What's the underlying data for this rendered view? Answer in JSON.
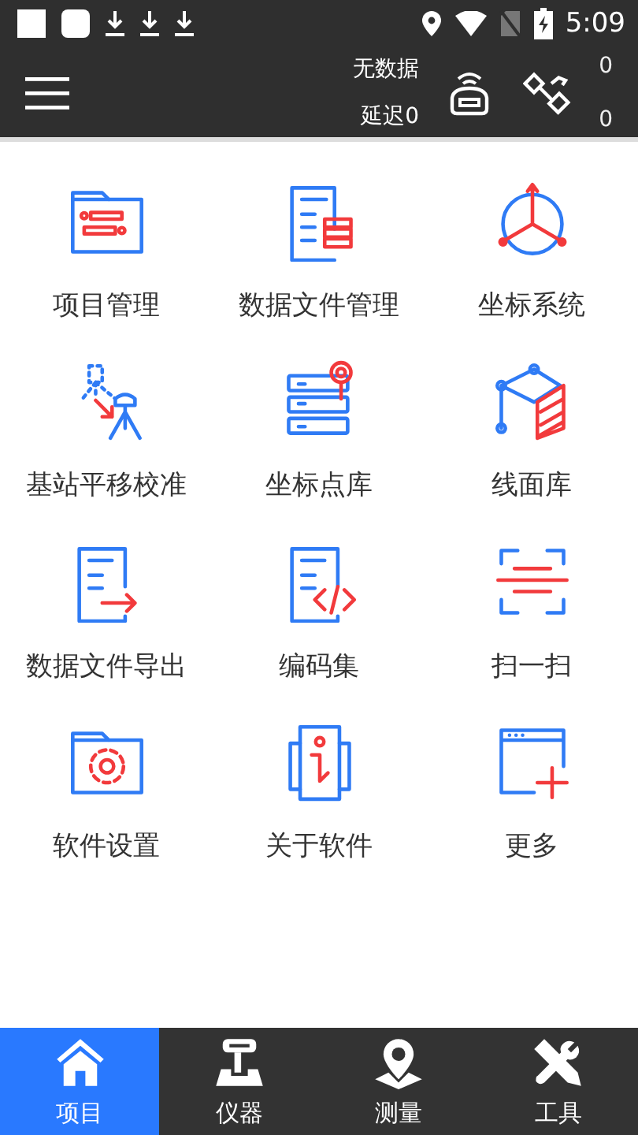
{
  "status_bar": {
    "time": "5:09"
  },
  "app_bar": {
    "status_text": "无数据",
    "delay": "延迟0",
    "counts": [
      "0",
      "0"
    ]
  },
  "menu_items": [
    {
      "label": "项目管理"
    },
    {
      "label": "数据文件管理"
    },
    {
      "label": "坐标系统"
    },
    {
      "label": "基站平移校准"
    },
    {
      "label": "坐标点库"
    },
    {
      "label": "线面库"
    },
    {
      "label": "数据文件导出"
    },
    {
      "label": "编码集"
    },
    {
      "label": "扫一扫"
    },
    {
      "label": "软件设置"
    },
    {
      "label": "关于软件"
    },
    {
      "label": "更多"
    }
  ],
  "bottom_nav": [
    {
      "label": "项目",
      "selected": true
    },
    {
      "label": "仪器",
      "selected": false
    },
    {
      "label": "测量",
      "selected": false
    },
    {
      "label": "工具",
      "selected": false
    }
  ]
}
